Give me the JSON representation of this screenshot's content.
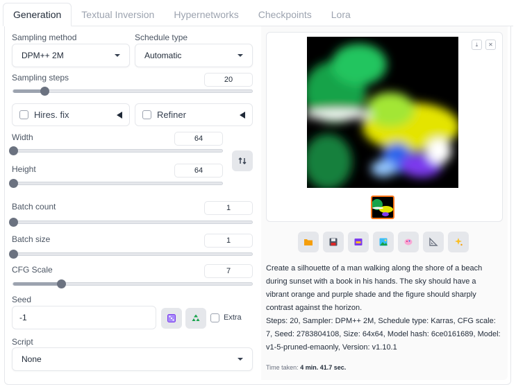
{
  "tabs": [
    "Generation",
    "Textual Inversion",
    "Hypernetworks",
    "Checkpoints",
    "Lora"
  ],
  "sampling": {
    "method_label": "Sampling method",
    "method_value": "DPM++ 2M",
    "schedule_label": "Schedule type",
    "schedule_value": "Automatic",
    "steps_label": "Sampling steps",
    "steps_value": "20",
    "steps_fraction": 0.13
  },
  "hires": {
    "label": "Hires. fix",
    "checked": false
  },
  "refiner": {
    "label": "Refiner",
    "checked": false
  },
  "width": {
    "label": "Width",
    "value": "64",
    "fraction": 0.0
  },
  "height": {
    "label": "Height",
    "value": "64",
    "fraction": 0.0
  },
  "swap_icon": "swap-vertical-icon",
  "batch_count": {
    "label": "Batch count",
    "value": "1",
    "fraction": 0.0
  },
  "batch_size": {
    "label": "Batch size",
    "value": "1",
    "fraction": 0.0
  },
  "cfg": {
    "label": "CFG Scale",
    "value": "7",
    "fraction": 0.2
  },
  "seed": {
    "label": "Seed",
    "value": "-1",
    "extra_label": "Extra",
    "dice_icon": "dice-icon",
    "recycle_icon": "recycle-icon"
  },
  "script": {
    "label": "Script",
    "value": "None"
  },
  "output": {
    "prompt": "Create a silhouette of a man walking along the shore of a beach during sunset with a book in his hands. The sky should have a vibrant orange and purple shade and the figure should sharply contrast against the horizon.",
    "params": "Steps: 20, Sampler: DPM++ 2M, Schedule type: Karras, CFG scale: 7, Seed: 2783804108, Size: 64x64, Model hash: 6ce0161689, Model: v1-5-pruned-emaonly, Version: v1.10.1",
    "time_label": "Time taken:",
    "time_value": "4 min. 41.7 sec.",
    "action_icons": [
      "folder-icon",
      "save-icon",
      "zip-icon",
      "send-to-img2img-icon",
      "send-to-inpaint-icon",
      "send-to-extras-icon",
      "sparkle-icon"
    ],
    "download_icon": "download-icon",
    "close_icon": "close-icon"
  },
  "colors": {
    "slider_thumb": "#6b7280",
    "selected_thumb_border": "#f97316"
  }
}
